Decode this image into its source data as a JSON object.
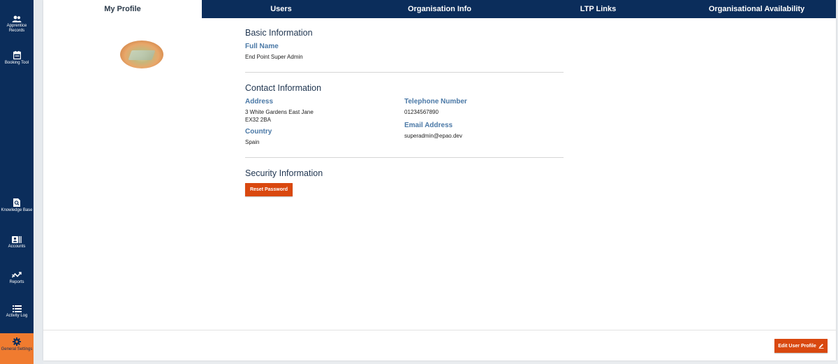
{
  "sidebar": {
    "items": [
      {
        "label": "Apprentice Records",
        "icon": "users-icon"
      },
      {
        "label": "Booking Tool",
        "icon": "calendar-icon"
      },
      {
        "label": "Knowledge Base",
        "icon": "document-search-icon"
      },
      {
        "label": "Accounts",
        "icon": "id-card-icon"
      },
      {
        "label": "Reports",
        "icon": "chart-trend-icon"
      },
      {
        "label": "Activity Log",
        "icon": "list-icon"
      },
      {
        "label": "General Settings",
        "icon": "gear-icon",
        "active": true
      }
    ]
  },
  "tabs": [
    {
      "label": "My Profile",
      "active": true
    },
    {
      "label": "Users"
    },
    {
      "label": "Organisation Info"
    },
    {
      "label": "LTP Links"
    },
    {
      "label": "Organisational Availability"
    }
  ],
  "basic": {
    "title": "Basic Information",
    "full_name_label": "Full Name",
    "full_name": "End Point Super Admin"
  },
  "contact": {
    "title": "Contact Information",
    "address_label": "Address",
    "address_line1": "3 White Gardens East Jane",
    "address_line2": "EX32 2BA",
    "country_label": "Country",
    "country": "Spain",
    "phone_label": "Telephone Number",
    "phone": "01234567890",
    "email_label": "Email Address",
    "email": "superadmin@epao.dev"
  },
  "security": {
    "title": "Security Information",
    "reset_label": "Reset Password"
  },
  "footer": {
    "edit_label": "Edit User Profile"
  },
  "colors": {
    "navy": "#0b2d5b",
    "accent_orange": "#d9480f",
    "active_sidebar": "#f07b2f",
    "label_blue": "#4a78a6"
  }
}
